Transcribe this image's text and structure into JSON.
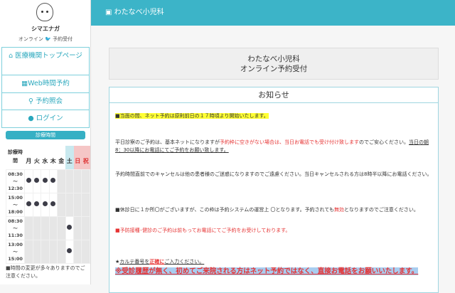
{
  "user": {
    "name": "シマエナガ",
    "sub_prefix": "オンライン",
    "sub_suffix": "予約受付"
  },
  "nav": [
    {
      "label": "医療機関トップページ",
      "icon": "home-icon"
    },
    {
      "label": "Web時間予約",
      "icon": "calendar-icon"
    },
    {
      "label": "予約照会",
      "icon": "search-icon"
    },
    {
      "label": "ログイン",
      "icon": "user-circle-icon"
    }
  ],
  "schedule": {
    "title": "診療時間",
    "header_label": "診療時間",
    "days": [
      "月",
      "火",
      "水",
      "木",
      "金",
      "土",
      "日",
      "祝"
    ],
    "rows": [
      {
        "time": [
          "08:30",
          "〜",
          "12:30"
        ],
        "open": [
          1,
          1,
          1,
          1,
          0,
          0,
          0,
          0
        ],
        "gray": [
          0,
          0,
          0,
          0,
          1,
          1,
          1,
          1
        ]
      },
      {
        "time": [
          "15:00",
          "〜",
          "18:00"
        ],
        "open": [
          1,
          1,
          1,
          1,
          0,
          0,
          0,
          0
        ],
        "gray": [
          0,
          0,
          0,
          0,
          1,
          1,
          1,
          1
        ]
      },
      {
        "time": [
          "08:30",
          "〜",
          "11:30"
        ],
        "open": [
          0,
          0,
          0,
          0,
          0,
          1,
          0,
          0
        ],
        "gray": [
          1,
          1,
          1,
          1,
          1,
          0,
          1,
          1
        ]
      },
      {
        "time": [
          "13:00",
          "〜",
          "15:00"
        ],
        "open": [
          0,
          0,
          0,
          0,
          0,
          1,
          0,
          0
        ],
        "gray": [
          1,
          1,
          1,
          1,
          1,
          0,
          1,
          1
        ]
      }
    ],
    "note": "■時間の変更が多々ありますのでご注意ください。"
  },
  "header": {
    "clinic": "わたなべ小児科"
  },
  "title": {
    "line1": "わたなべ小児科",
    "line2": "オンライン予約受付"
  },
  "notice": {
    "heading": "お知らせ",
    "p1": "■当面の間、ネット予約は原則前日の１７時頃より開始いたします。",
    "p2a": "平日診察のご予約は、基本ネットになりますが",
    "p2b": "予約枠に空きがない場合は、当日お電話でも受け付け致します",
    "p2c": "のでご安心ください。",
    "p2d": "当日の朝8：30以降にお電話にてご予約をお願い致します。",
    "p3": "予約時間直前でのキャンセルは他の患者様のご迷惑になりますのでご遠慮ください。当日キャンセルされる方は8時半以降にお電話ください。",
    "p4a": "■休診日に１か所〇がございますが、この枠は予約システムの運営上 〇となります。予約されても",
    "p4b": "無効",
    "p4c": "となりますのでご注意ください。",
    "p5": "■予防接種･健診のご予約は前もってお電話にてご予約をお受けしております。",
    "p6a": "★",
    "p6b": "カルテ番号を",
    "p6c": "正確に",
    "p6d": "ご入力ください。",
    "p7": "※受診履歴が無く、初めてご来院される方はネット予約ではなく、直接お電話をお願いいたします。"
  }
}
